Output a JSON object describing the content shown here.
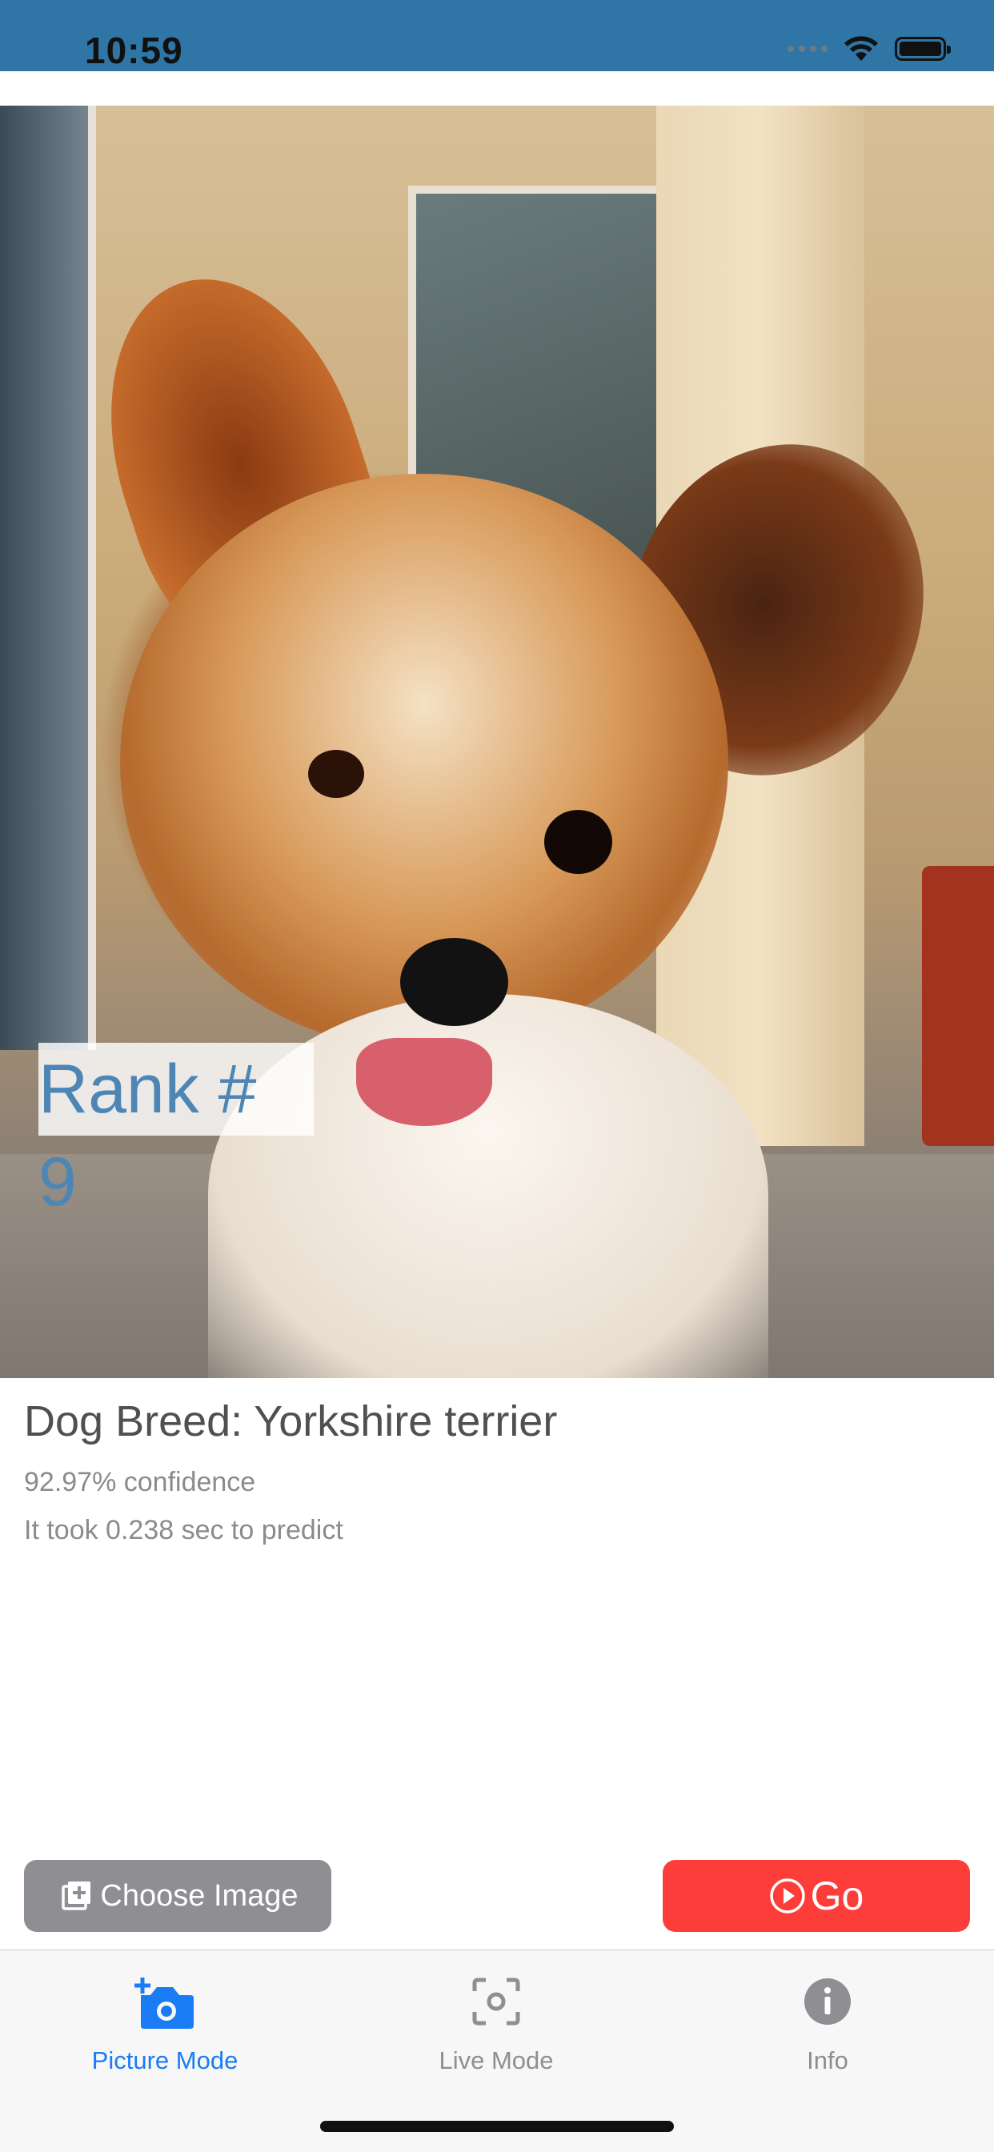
{
  "status_bar": {
    "time": "10:59",
    "background": "#2f75a6"
  },
  "photo": {
    "subject": "dog-photo",
    "overlay_label": "Rank # 9"
  },
  "result": {
    "breed": "Dog Breed: Yorkshire terrier",
    "confidence": "92.97% confidence",
    "prediction_time": "It took 0.238 sec to predict"
  },
  "buttons": {
    "choose_image": "Choose Image",
    "go": "Go",
    "choose_color": "#8e8e93",
    "go_color": "#fc3d39"
  },
  "tabs": [
    {
      "label": "Picture Mode",
      "icon": "camera-plus-icon",
      "selected": true
    },
    {
      "label": "Live Mode",
      "icon": "viewfinder-icon",
      "selected": false
    },
    {
      "label": "Info",
      "icon": "info-icon",
      "selected": false
    }
  ],
  "colors": {
    "accent": "#1a7cf5",
    "tab_inactive": "#8e8e93",
    "rank_text": "#4d86b5"
  }
}
